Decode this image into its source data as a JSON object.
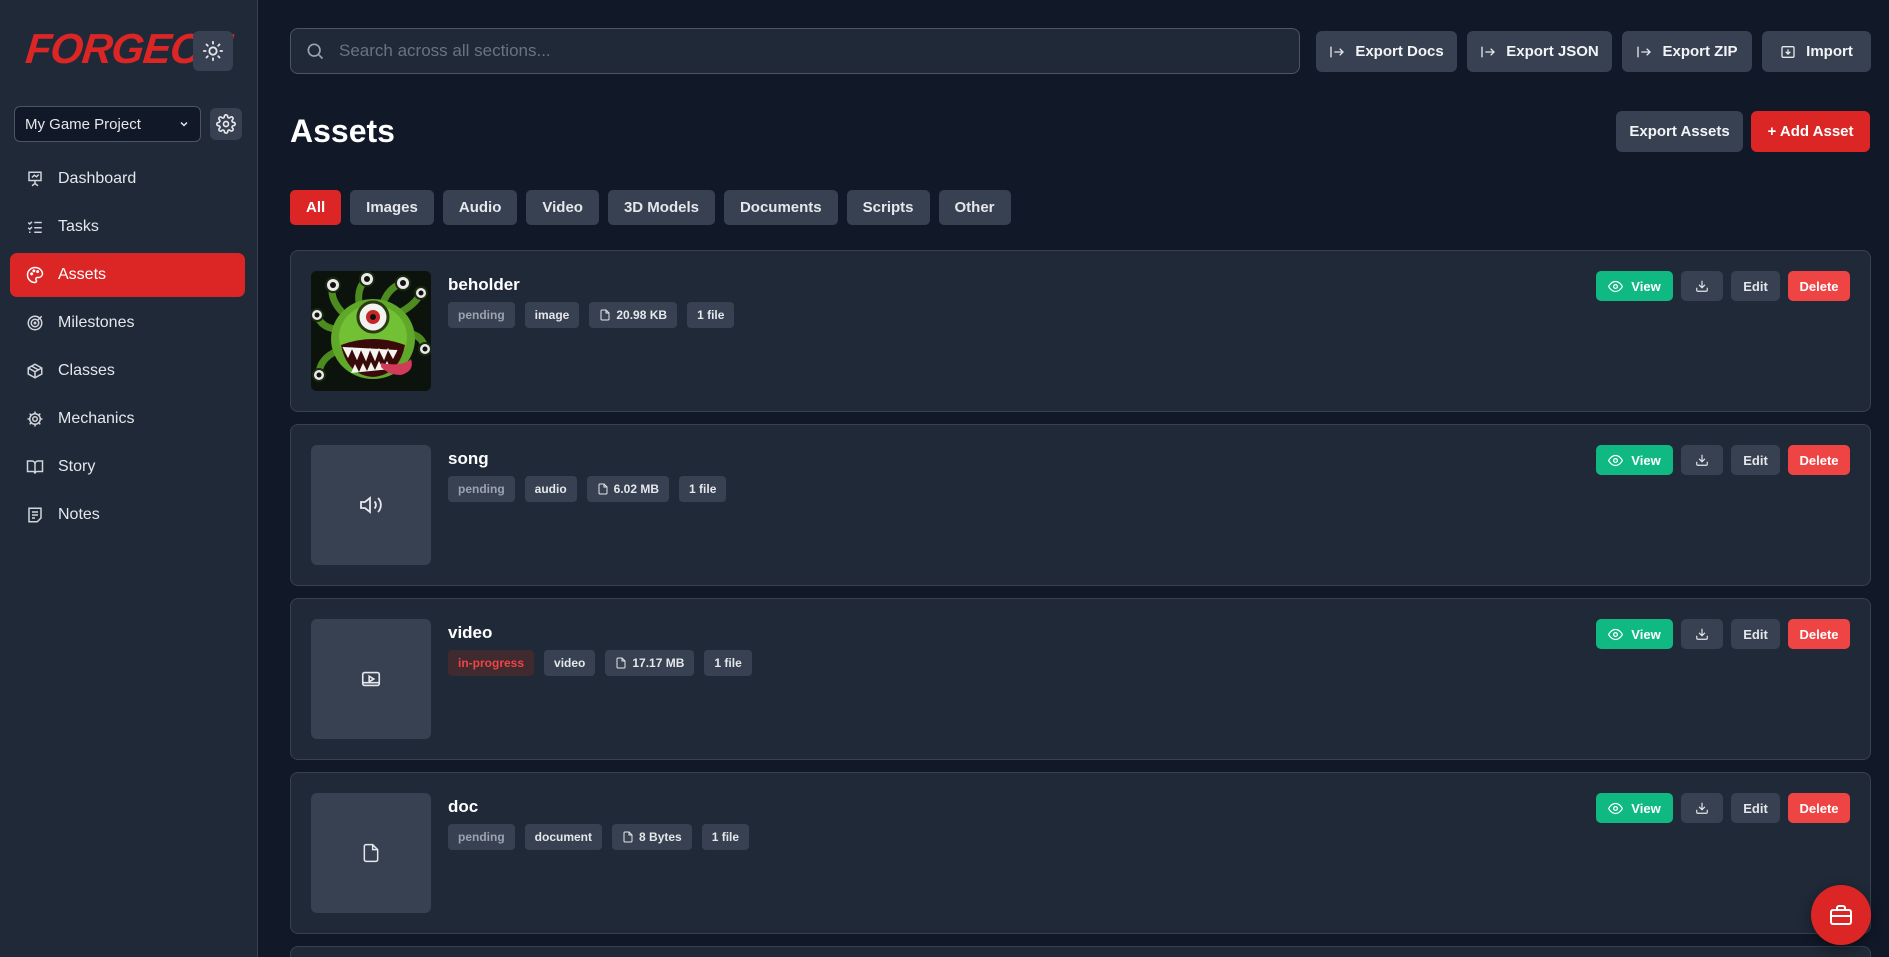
{
  "app": {
    "logo": "FORGEON"
  },
  "sidebar": {
    "project": "My Game Project",
    "items": [
      {
        "label": "Dashboard",
        "icon": "presentation-icon"
      },
      {
        "label": "Tasks",
        "icon": "list-checks-icon"
      },
      {
        "label": "Assets",
        "icon": "palette-icon",
        "active": true
      },
      {
        "label": "Milestones",
        "icon": "target-icon"
      },
      {
        "label": "Classes",
        "icon": "box-icon"
      },
      {
        "label": "Mechanics",
        "icon": "cog-icon"
      },
      {
        "label": "Story",
        "icon": "book-icon"
      },
      {
        "label": "Notes",
        "icon": "notes-icon"
      }
    ]
  },
  "header": {
    "search_placeholder": "Search across all sections...",
    "export_docs": "Export Docs",
    "export_json": "Export JSON",
    "export_zip": "Export ZIP",
    "import": "Import"
  },
  "page": {
    "title": "Assets",
    "export_assets": "Export Assets",
    "add_asset": "+ Add Asset"
  },
  "filters": [
    "All",
    "Images",
    "Audio",
    "Video",
    "3D Models",
    "Documents",
    "Scripts",
    "Other"
  ],
  "assets": [
    {
      "name": "beholder",
      "status": "pending",
      "type": "image",
      "size": "20.98 KB",
      "files": "1 file"
    },
    {
      "name": "song",
      "status": "pending",
      "type": "audio",
      "size": "6.02 MB",
      "files": "1 file"
    },
    {
      "name": "video",
      "status": "in-progress",
      "type": "video",
      "size": "17.17 MB",
      "files": "1 file"
    },
    {
      "name": "doc",
      "status": "pending",
      "type": "document",
      "size": "8 Bytes",
      "files": "1 file"
    }
  ],
  "actions": {
    "view": "View",
    "edit": "Edit",
    "delete": "Delete"
  },
  "colors": {
    "accent": "#dc2626",
    "success": "#10b981",
    "danger": "#ef4444",
    "bg": "#111827",
    "panel": "#1f2937"
  }
}
